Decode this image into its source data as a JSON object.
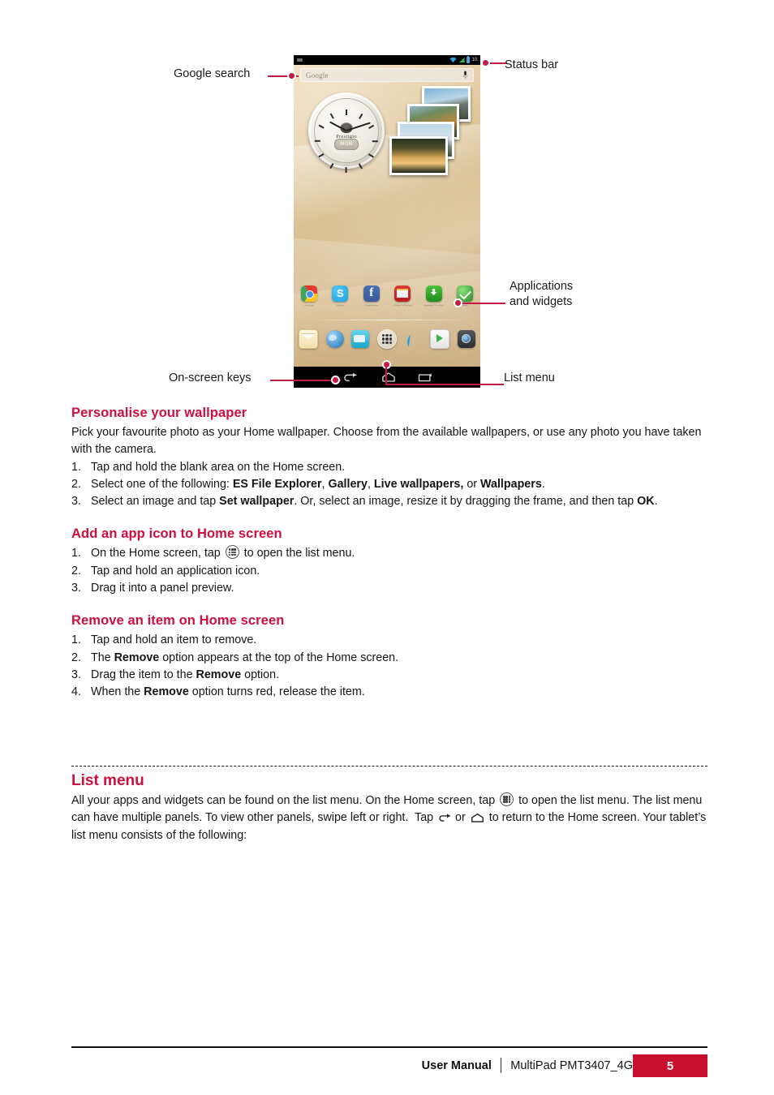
{
  "figure": {
    "callouts": [
      {
        "id": "google-search",
        "label": "Google search"
      },
      {
        "id": "status-bar",
        "label": "Status bar"
      },
      {
        "id": "applications-and-widgets",
        "label_line1": "Applications",
        "label_line2": "and widgets"
      },
      {
        "id": "on-screen-keys",
        "label": "On-screen keys"
      },
      {
        "id": "list-menu",
        "label": "List menu"
      }
    ],
    "device": {
      "search_placeholder": "Google",
      "status_icons": [
        "wifi-icon",
        "signal-icon",
        "battery-icon"
      ],
      "status_time": "10:",
      "clock_widget": {
        "brand": "Prestigio",
        "day": "MON"
      },
      "apps": [
        {
          "name": "chrome-icon",
          "label": "Google"
        },
        {
          "name": "skype-icon",
          "label": "Skype"
        },
        {
          "name": "facebook-icon",
          "label": "Facebook"
        },
        {
          "name": "emergency-shield-icon",
          "label": "eTutor eFamily"
        },
        {
          "name": "installer-shield-icon",
          "label": "Installer Family"
        },
        {
          "name": "security-shield-icon",
          "label": "Navi"
        }
      ],
      "dock": [
        {
          "name": "email-icon"
        },
        {
          "name": "browser-icon"
        },
        {
          "name": "file-manager-icon"
        },
        {
          "name": "app-drawer-icon"
        },
        {
          "name": "phone-icon"
        },
        {
          "name": "play-store-icon"
        },
        {
          "name": "camera-icon"
        }
      ],
      "nav_keys": [
        {
          "name": "back-key"
        },
        {
          "name": "home-key"
        },
        {
          "name": "recent-apps-key"
        }
      ]
    }
  },
  "sections": [
    {
      "id": "personalise-your-wallpaper",
      "heading": "Personalise your wallpaper",
      "intro": "Pick your favourite photo as your Home wallpaper. Choose from the available wallpapers, or use any photo you have taken with the camera.",
      "steps": [
        {
          "num": "1.",
          "html": "Tap and hold the blank area on the Home screen."
        },
        {
          "num": "2.",
          "html": "Select one of the following: <b>ES File Explorer</b>, <b>Gallery</b>, <b>Live wallpapers,</b> or <b>Wallpapers</b>."
        },
        {
          "num": "3.",
          "html": "Select an image and tap <b>Set wallpaper</b>. Or, select an image, resize it by dragging the frame, and then tap <b>OK</b>."
        }
      ]
    },
    {
      "id": "add-an-app-icon-to-home-screen",
      "heading": "Add an app icon to Home screen",
      "steps": [
        {
          "num": "1.",
          "html": "On the Home screen, tap <span class=\"inline-drawer\" data-name=\"app-drawer-icon\" data-interactable=\"false\"><span class=\"g\"><b></b><b></b><b></b><b></b><b></b><b></b><b></b><b></b><b></b></span></span> to open the list menu."
        },
        {
          "num": "2.",
          "html": "Tap and hold an application icon."
        },
        {
          "num": "3.",
          "html": "Drag it into a panel preview."
        }
      ]
    },
    {
      "id": "remove-an-item-on-home-screen",
      "heading": "Remove an item on Home screen",
      "steps": [
        {
          "num": "1.",
          "html": "Tap and hold an item to remove."
        },
        {
          "num": "2.",
          "html": "The <b>Remove</b> option appears at the top of the Home screen."
        },
        {
          "num": "3.",
          "html": "Drag the item to the <b>Remove</b> option."
        },
        {
          "num": "4.",
          "html": "When the <b>Remove</b> option turns red, release the item."
        }
      ]
    }
  ],
  "list_menu": {
    "heading": "List menu",
    "paragraph_html": "All your apps and widgets can be found on the list menu. On the Home screen, tap <span class=\"inline-drawer\" data-name=\"app-drawer-icon\" data-interactable=\"false\"><span class=\"g\"><b></b><b></b><b></b><b></b><b></b><b></b><b></b><b></b><b></b></span></span> to open the list menu. The list menu can have multiple panels. To view other panels, swipe left or right.&nbsp; Tap <span class=\"inline-back\" data-name=\"back-key-icon\" data-interactable=\"false\"><svg viewBox=\"0 0 22 16\"><path d=\"M20 5 H8 a4 4 0 1 0 0 8 H10\" fill=\"none\" stroke=\"#1a1a1a\" stroke-width=\"1.7\" stroke-linecap=\"round\"/><path d=\"M20 5 L15.5 1.6 L15.5 8.4 Z\" fill=\"#1a1a1a\"/></svg></span> or <span class=\"inline-home\" data-name=\"home-key-icon\" data-interactable=\"false\"><svg viewBox=\"0 0 24 16\"><path d=\"M3.5 14 L3.5 7.5 L12 2 L20.5 7.5 L20.5 14 Z\" fill=\"none\" stroke=\"#1a1a1a\" stroke-width=\"1.7\" stroke-linejoin=\"round\"/></svg></span> to return to the Home screen. Your tablet’s list menu consists of the following:"
  },
  "footer": {
    "user_manual": "User Manual",
    "model": "MultiPad PMT3407_4G",
    "page_number": "5"
  },
  "colors": {
    "accent_heading": "#ce0e3f",
    "accent_badge": "#c8102e",
    "callout_line": "#c41a45"
  }
}
